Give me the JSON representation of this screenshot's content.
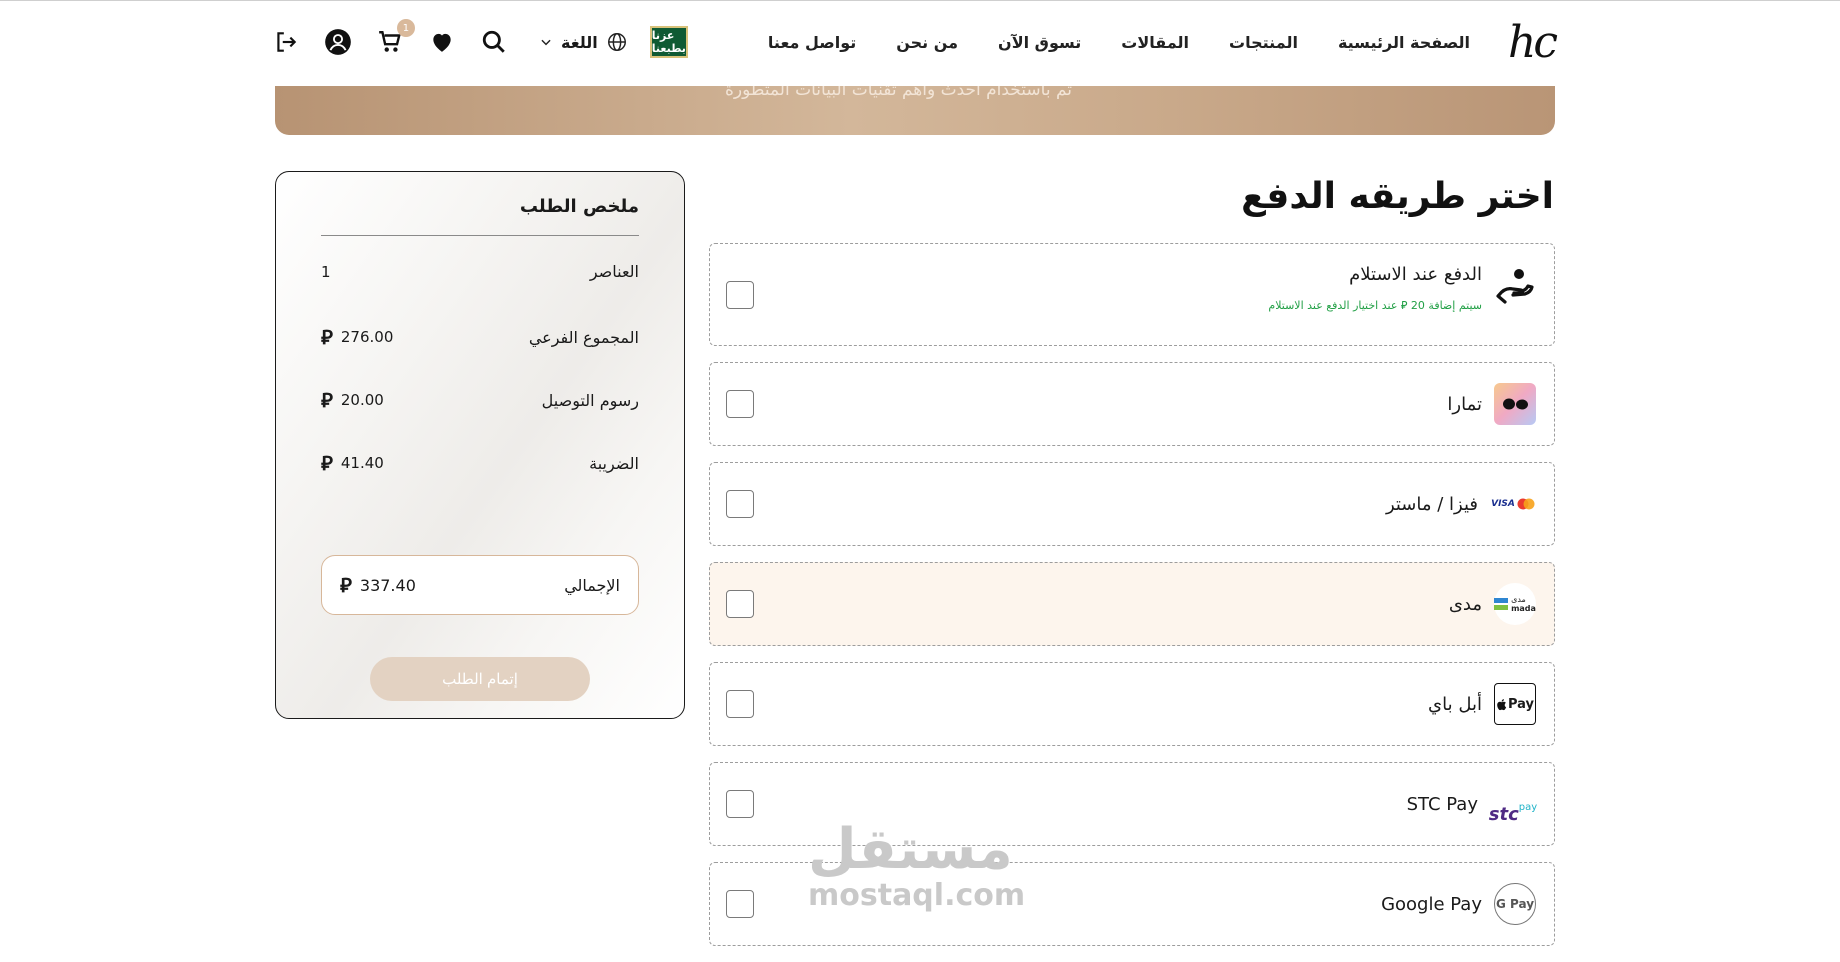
{
  "header": {
    "logo": "hc",
    "nav": [
      "الصفحة الرئيسية",
      "المنتجات",
      "المقالات",
      "تسوق الآن",
      "من نحن",
      "تواصل معنا"
    ],
    "badge": "عزنا بطبعنا",
    "language_label": "اللغة",
    "cart_count": "1"
  },
  "banner": {
    "text": "تم باستخدام أحدث وأهم تقنيات البيانات المتطورة"
  },
  "payment": {
    "title": "اختر طريقه الدفع",
    "methods": [
      {
        "label": "الدفع عند الاستلام",
        "note": "سيتم إضافة 20 ⃁ عند اختيار الدفع عند الاستلام",
        "logo": "hand-coin-icon"
      },
      {
        "label": "تمارا",
        "logo": "tamara-logo"
      },
      {
        "label": "فيزا / ماستر",
        "logo": "visa-mastercard-logo"
      },
      {
        "label": "مدى",
        "logo": "mada-logo",
        "selected": true
      },
      {
        "label": "أبل باي",
        "logo": "apple-pay-logo"
      },
      {
        "label": "STC Pay",
        "logo": "stc-pay-logo"
      },
      {
        "label": "Google Pay",
        "logo": "google-pay-logo"
      }
    ],
    "logo_texts": {
      "visa": "VISA",
      "mada_ar": "مدى",
      "mada_en": "mada",
      "apple": "Pay",
      "stc": "stc",
      "stc_pay": "pay",
      "gpay": "G Pay"
    }
  },
  "summary": {
    "title": "ملخص الطلب",
    "items_label": "العناصر",
    "items_value": "1",
    "subtotal_label": "المجموع الفرعي",
    "subtotal_value": "276.00",
    "shipping_label": "رسوم التوصيل",
    "shipping_value": "20.00",
    "tax_label": "الضريبة",
    "tax_value": "41.40",
    "total_label": "الإجمالي",
    "total_value": "337.40",
    "currency_symbol": "⃁",
    "complete_button": "إتمام الطلب"
  },
  "watermark": {
    "arabic": "مستقل",
    "latin": "mostaql.com"
  },
  "colors": {
    "accent": "#d9b99b",
    "selected_bg": "#fdf5ed",
    "note_green": "#22a046"
  }
}
